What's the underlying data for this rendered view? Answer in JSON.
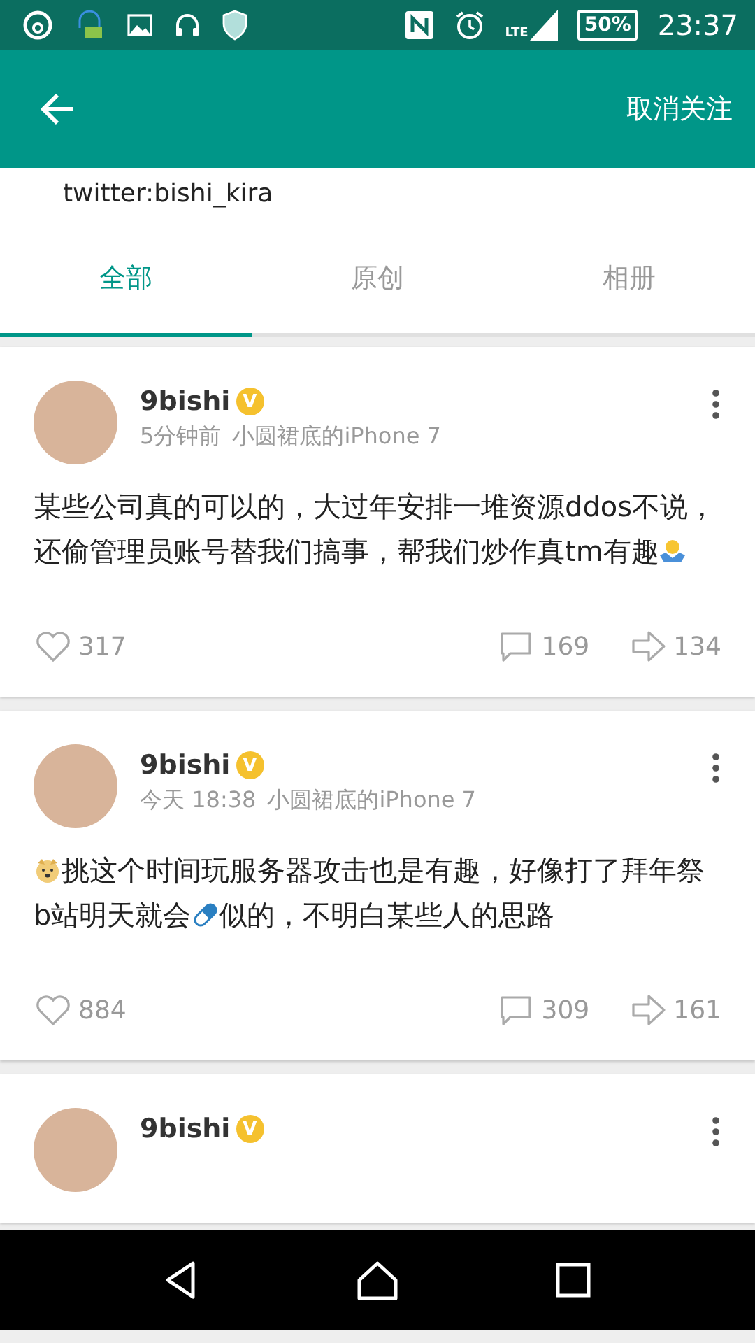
{
  "status_bar": {
    "network": "LTE",
    "battery": "50%",
    "time": "23:37"
  },
  "app_bar": {
    "action": "取消关注"
  },
  "profile": {
    "bio": "twitter:bishi_kira"
  },
  "tabs": [
    {
      "label": "全部",
      "selected": true
    },
    {
      "label": "原创",
      "selected": false
    },
    {
      "label": "相册",
      "selected": false
    }
  ],
  "posts": [
    {
      "author": "9bishi",
      "badge": "V",
      "time": "5分钟前",
      "source": "小圆裙底的iPhone 7",
      "body": [
        {
          "kind": "text",
          "text": "某些公司真的可以的，大过年安排一堆资源ddos不说，还偷管理员账号替我们搞事，帮我们炒作真tm有趣"
        },
        {
          "kind": "emoji-shrug"
        }
      ],
      "likes": "317",
      "comments": "169",
      "reposts": "134"
    },
    {
      "author": "9bishi",
      "badge": "V",
      "time": "今天 18:38",
      "source": "小圆裙底的iPhone 7",
      "body": [
        {
          "kind": "emoji-dog"
        },
        {
          "kind": "text",
          "text": "挑这个时间玩服务器攻击也是有趣，好像打了拜年祭b站明天就会"
        },
        {
          "kind": "emoji-pill"
        },
        {
          "kind": "text",
          "text": "似的，不明白某些人的思路"
        }
      ],
      "likes": "884",
      "comments": "309",
      "reposts": "161"
    },
    {
      "author": "9bishi",
      "badge": "V"
    }
  ]
}
